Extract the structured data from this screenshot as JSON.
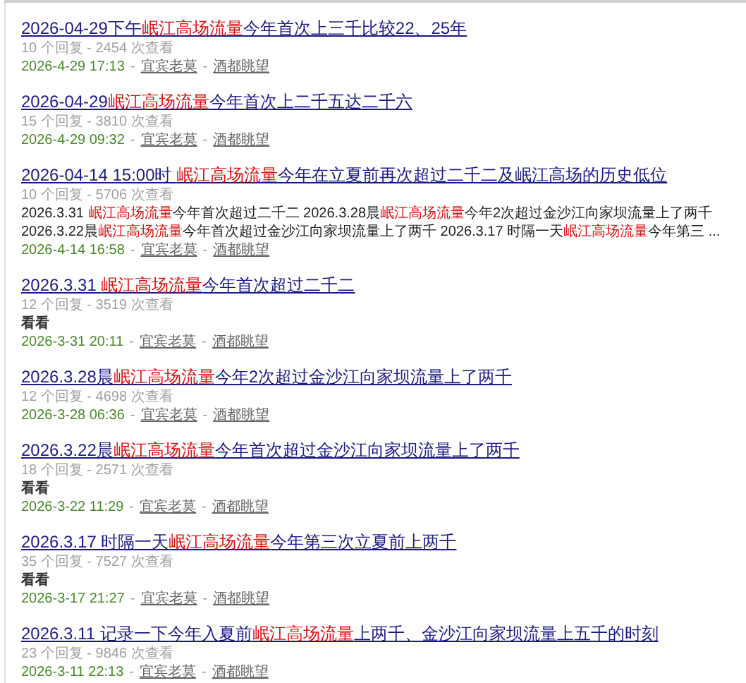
{
  "results": [
    {
      "title": [
        {
          "text": "2026-04-29下午",
          "highlight": false
        },
        {
          "text": "岷江高场流量",
          "highlight": true
        },
        {
          "text": "今年首次上三千比较22、25年",
          "highlight": false
        }
      ],
      "stats": "10 个回复 - 2454 次查看",
      "byline": [
        {
          "kind": "date",
          "text": "2026-4-29 17:13"
        },
        {
          "kind": "separator",
          "text": "-"
        },
        {
          "kind": "link",
          "text": "宜宾老莫"
        },
        {
          "kind": "separator",
          "text": "-"
        },
        {
          "kind": "link",
          "text": "酒都眺望"
        }
      ]
    },
    {
      "title": [
        {
          "text": "2026-04-29",
          "highlight": false
        },
        {
          "text": "岷江高场流量",
          "highlight": true
        },
        {
          "text": "今年首次上二千五达二千六",
          "highlight": false
        }
      ],
      "stats": "15 个回复 - 3810 次查看",
      "byline": [
        {
          "kind": "date",
          "text": "2026-4-29 09:32"
        },
        {
          "kind": "separator",
          "text": "-"
        },
        {
          "kind": "link",
          "text": "宜宾老莫"
        },
        {
          "kind": "separator",
          "text": "-"
        },
        {
          "kind": "link",
          "text": "酒都眺望"
        }
      ]
    },
    {
      "title": [
        {
          "text": "2026-04-14 15:00时 ",
          "highlight": false
        },
        {
          "text": "岷江高场流量",
          "highlight": true
        },
        {
          "text": "今年在立夏前再次超过二千二及岷江高场的历史低位",
          "highlight": false
        }
      ],
      "stats": "10 个回复 - 5706 次查看",
      "snippet": {
        "bold": false,
        "segments": [
          {
            "text": "2026.3.31 ",
            "highlight": false
          },
          {
            "text": "岷江高场流量",
            "highlight": true
          },
          {
            "text": "今年首次超过二千二 2026.3.28晨",
            "highlight": false
          },
          {
            "text": "岷江高场流量",
            "highlight": true
          },
          {
            "text": "今年2次超过金沙江向家坝流量上了两千 2026.3.22晨",
            "highlight": false
          },
          {
            "text": "岷江高场流量",
            "highlight": true
          },
          {
            "text": "今年首次超过金沙江向家坝流量上了两千 2026.3.17 时隔一天",
            "highlight": false
          },
          {
            "text": "岷江高场流量",
            "highlight": true
          },
          {
            "text": "今年第三 ...",
            "highlight": false
          }
        ]
      },
      "byline": [
        {
          "kind": "date",
          "text": "2026-4-14 16:58"
        },
        {
          "kind": "separator",
          "text": "-"
        },
        {
          "kind": "link",
          "text": "宜宾老莫"
        },
        {
          "kind": "separator",
          "text": "-"
        },
        {
          "kind": "link",
          "text": "酒都眺望"
        }
      ]
    },
    {
      "title": [
        {
          "text": "2026.3.31 ",
          "highlight": false
        },
        {
          "text": "岷江高场流量",
          "highlight": true
        },
        {
          "text": "今年首次超过二千二",
          "highlight": false
        }
      ],
      "stats": "12 个回复 - 3519 次查看",
      "snippet": {
        "bold": true,
        "segments": [
          {
            "text": "看看",
            "highlight": false
          }
        ]
      },
      "byline": [
        {
          "kind": "date",
          "text": "2026-3-31 20:11"
        },
        {
          "kind": "separator",
          "text": "-"
        },
        {
          "kind": "link",
          "text": "宜宾老莫"
        },
        {
          "kind": "separator",
          "text": "-"
        },
        {
          "kind": "link",
          "text": "酒都眺望"
        }
      ]
    },
    {
      "title": [
        {
          "text": "2026.3.28晨",
          "highlight": false
        },
        {
          "text": "岷江高场流量",
          "highlight": true
        },
        {
          "text": "今年2次超过金沙江向家坝流量上了两千",
          "highlight": false
        }
      ],
      "stats": "12 个回复 - 4698 次查看",
      "byline": [
        {
          "kind": "date",
          "text": "2026-3-28 06:36"
        },
        {
          "kind": "separator",
          "text": "-"
        },
        {
          "kind": "link",
          "text": "宜宾老莫"
        },
        {
          "kind": "separator",
          "text": "-"
        },
        {
          "kind": "link",
          "text": "酒都眺望"
        }
      ]
    },
    {
      "title": [
        {
          "text": "2026.3.22晨",
          "highlight": false
        },
        {
          "text": "岷江高场流量",
          "highlight": true
        },
        {
          "text": "今年首次超过金沙江向家坝流量上了两千",
          "highlight": false
        }
      ],
      "stats": "18 个回复 - 2571 次查看",
      "snippet": {
        "bold": true,
        "segments": [
          {
            "text": "看看",
            "highlight": false
          }
        ]
      },
      "byline": [
        {
          "kind": "date",
          "text": "2026-3-22 11:29"
        },
        {
          "kind": "separator",
          "text": "-"
        },
        {
          "kind": "link",
          "text": "宜宾老莫"
        },
        {
          "kind": "separator",
          "text": "-"
        },
        {
          "kind": "link",
          "text": "酒都眺望"
        }
      ]
    },
    {
      "title": [
        {
          "text": "2026.3.17 时隔一天",
          "highlight": false
        },
        {
          "text": "岷江高场流量",
          "highlight": true
        },
        {
          "text": "今年第三次立夏前上两千",
          "highlight": false
        }
      ],
      "stats": "35 个回复 - 7527 次查看",
      "snippet": {
        "bold": true,
        "segments": [
          {
            "text": "看看",
            "highlight": false
          }
        ]
      },
      "byline": [
        {
          "kind": "date",
          "text": "2026-3-17 21:27"
        },
        {
          "kind": "separator",
          "text": "-"
        },
        {
          "kind": "link",
          "text": "宜宾老莫"
        },
        {
          "kind": "separator",
          "text": "-"
        },
        {
          "kind": "link",
          "text": "酒都眺望"
        }
      ]
    },
    {
      "title": [
        {
          "text": "2026.3.11 记录一下今年入夏前",
          "highlight": false
        },
        {
          "text": "岷江高场流量",
          "highlight": true
        },
        {
          "text": "上两千、金沙江向家坝流量上五千的时刻",
          "highlight": false
        }
      ],
      "stats": "23 个回复 - 9846 次查看",
      "byline": [
        {
          "kind": "date",
          "text": "2026-3-11 22:13"
        },
        {
          "kind": "separator",
          "text": "-"
        },
        {
          "kind": "link",
          "text": "宜宾老莫"
        },
        {
          "kind": "separator",
          "text": "-"
        },
        {
          "kind": "link",
          "text": "酒都眺望"
        }
      ]
    }
  ]
}
